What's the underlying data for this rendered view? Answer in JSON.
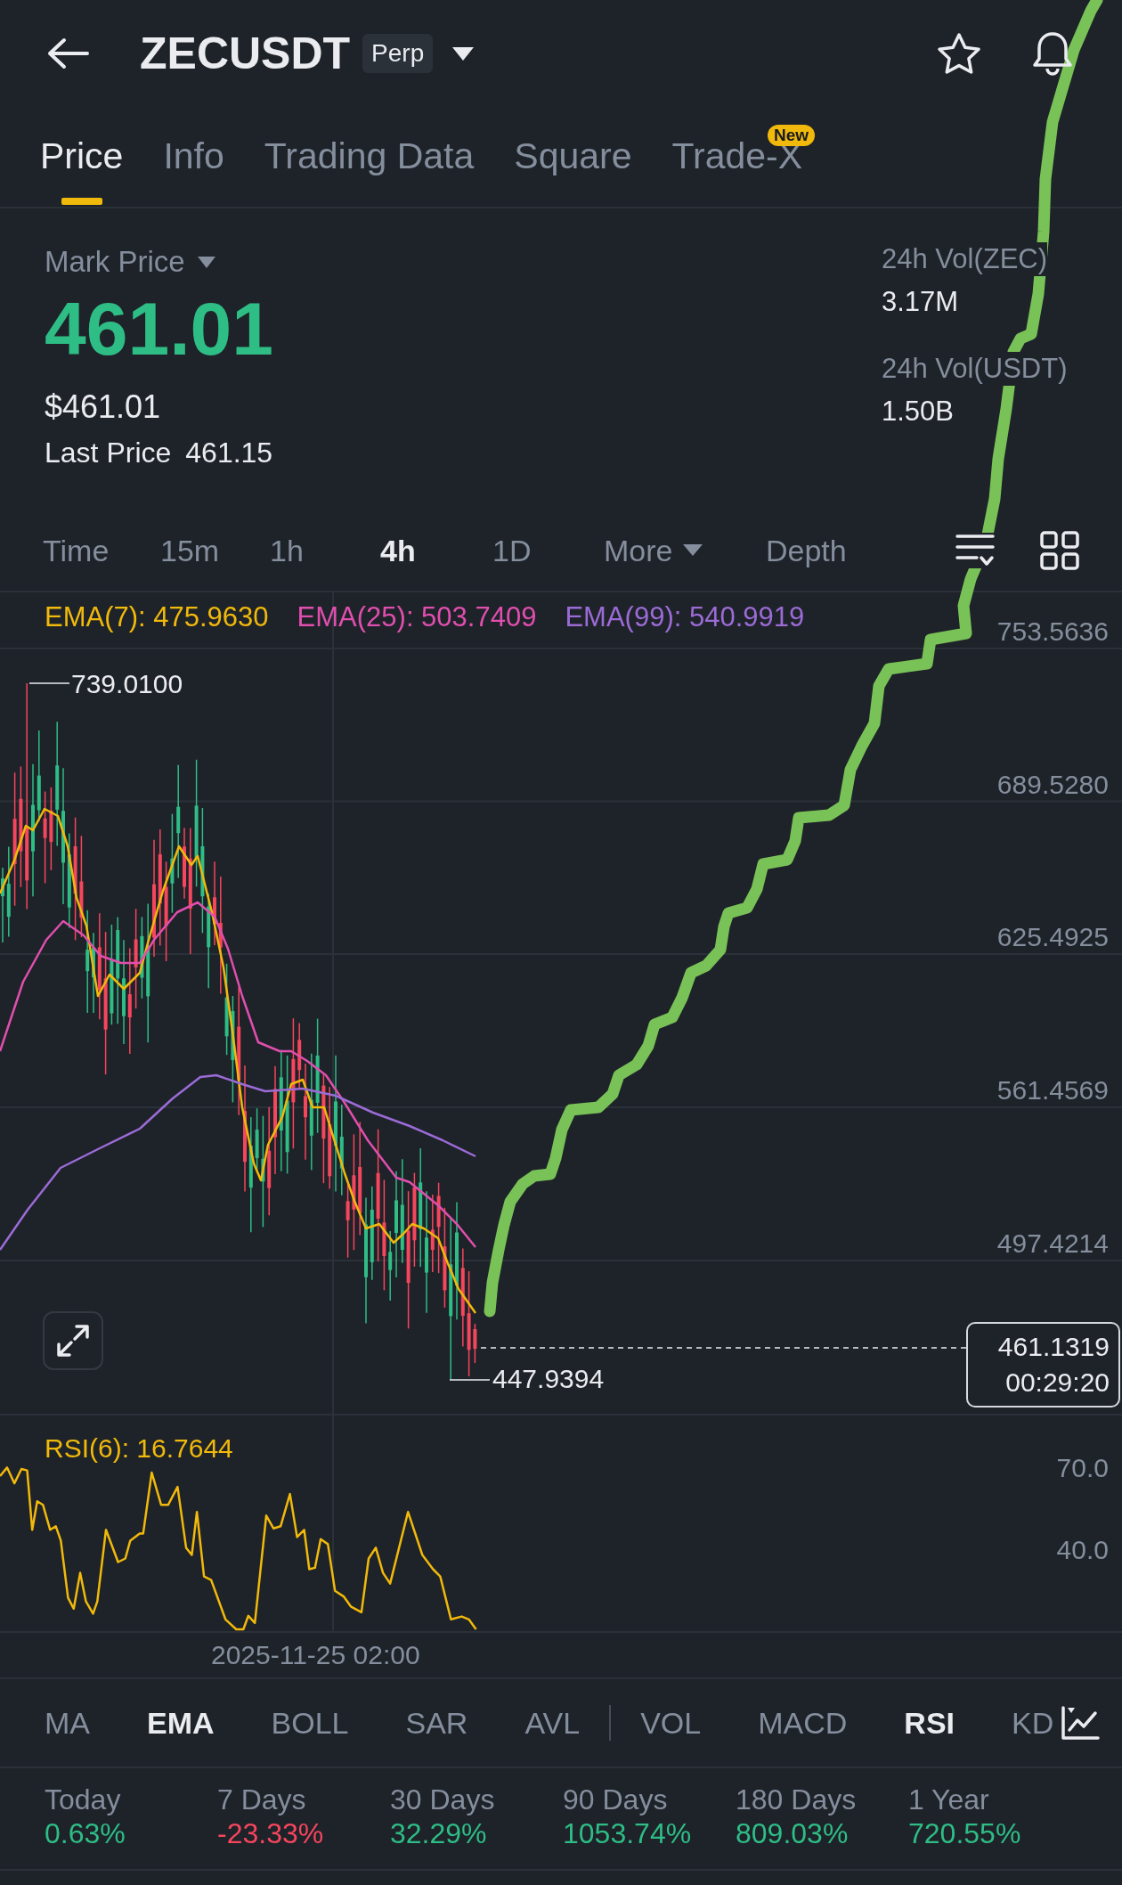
{
  "header": {
    "symbol": "ZECUSDT",
    "contract_type": "Perp"
  },
  "tabs": [
    {
      "label": "Price",
      "selected": true
    },
    {
      "label": "Info",
      "selected": false
    },
    {
      "label": "Trading Data",
      "selected": false
    },
    {
      "label": "Square",
      "selected": false
    },
    {
      "label": "Trade-X",
      "selected": false,
      "badge": "New"
    }
  ],
  "price_summary": {
    "label": "Mark Price",
    "price": "461.01",
    "price_usd": "$461.01",
    "last_price_label": "Last Price",
    "last_price": "461.15",
    "volumes": [
      {
        "label": "24h Vol(ZEC)",
        "value": "3.17M"
      },
      {
        "label": "24h Vol(USDT)",
        "value": "1.50B"
      }
    ]
  },
  "chart_tabs": [
    {
      "label": "Time",
      "kind": "option",
      "selected": false
    },
    {
      "label": "15m",
      "kind": "option",
      "selected": false
    },
    {
      "label": "1h",
      "kind": "option",
      "selected": false
    },
    {
      "label": "4h",
      "kind": "option",
      "selected": true
    },
    {
      "label": "1D",
      "kind": "option",
      "selected": false
    },
    {
      "label": "More",
      "kind": "dropdown",
      "selected": false
    },
    {
      "label": "Depth",
      "kind": "option",
      "selected": false
    }
  ],
  "chart": {
    "legend": [
      {
        "label": "EMA(7): 475.9630",
        "color": "#f0b90b"
      },
      {
        "label": "EMA(25): 503.7409",
        "color": "#e04fae"
      },
      {
        "label": "EMA(99): 540.9919",
        "color": "#9b6bd6"
      }
    ],
    "price_axis": [
      "753.5636",
      "689.5280",
      "625.4925",
      "561.4569",
      "497.4214"
    ],
    "high_label": "739.0100",
    "low_label": "447.9394",
    "current_price": "461.1319",
    "countdown": "00:29:20"
  },
  "rsi": {
    "label": "RSI(6): 16.7644",
    "axis": [
      "70.0",
      "40.0"
    ]
  },
  "time_axis": "2025-11-25 02:00",
  "indicators": [
    {
      "label": "MA",
      "divider_before": false,
      "selected": false
    },
    {
      "label": "EMA",
      "divider_before": false,
      "selected": true
    },
    {
      "label": "BOLL",
      "divider_before": false,
      "selected": false
    },
    {
      "label": "SAR",
      "divider_before": false,
      "selected": false
    },
    {
      "label": "AVL",
      "divider_before": false,
      "selected": false
    },
    {
      "label": "VOL",
      "divider_before": true,
      "selected": false
    },
    {
      "label": "MACD",
      "divider_before": false,
      "selected": false
    },
    {
      "label": "RSI",
      "divider_before": false,
      "selected": true
    },
    {
      "label": "KD",
      "divider_before": false,
      "selected": false
    }
  ],
  "performance": [
    {
      "label": "Today",
      "value": "0.63%",
      "negative": false
    },
    {
      "label": "7 Days",
      "value": "-23.33%",
      "negative": true
    },
    {
      "label": "30 Days",
      "value": "32.29%",
      "negative": false
    },
    {
      "label": "90 Days",
      "value": "1053.74%",
      "negative": false
    },
    {
      "label": "180 Days",
      "value": "809.03%",
      "negative": false
    },
    {
      "label": "1 Year",
      "value": "720.55%",
      "negative": false
    }
  ]
}
